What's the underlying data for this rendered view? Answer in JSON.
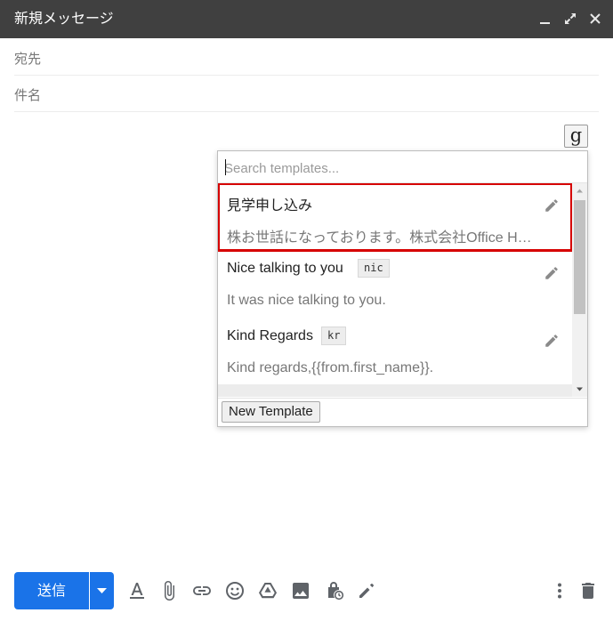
{
  "window": {
    "title": "新規メッセージ",
    "controls": [
      "minimize-icon",
      "expand-icon",
      "close-icon"
    ]
  },
  "compose": {
    "to_label": "宛先",
    "subject_label": "件名"
  },
  "extension_button": {
    "label": "g"
  },
  "templates_popup": {
    "search_placeholder": "Search templates...",
    "items": [
      {
        "name": "見学申し込み",
        "shortcut": "",
        "body": "株お世話になっております。株式会社Office Ha…",
        "highlighted": true
      },
      {
        "name": "Nice talking to you",
        "shortcut": "nic",
        "body": "It was nice talking to you.",
        "highlighted": false
      },
      {
        "name": "Kind Regards",
        "shortcut": "kr",
        "body": "Kind regards,{{from.first_name}}.",
        "highlighted": false
      }
    ],
    "new_template_label": "New Template"
  },
  "toolbar": {
    "send_label": "送信",
    "icons": [
      "text-format-icon",
      "attach-icon",
      "link-icon",
      "emoji-icon",
      "drive-icon",
      "image-icon",
      "confidential-icon",
      "signature-icon",
      "more-options-icon",
      "delete-icon"
    ]
  },
  "colors": {
    "titlebar": "#404040",
    "send_button": "#1a73e8",
    "highlight_border": "#d60000",
    "icon_gray": "#5f6368"
  }
}
